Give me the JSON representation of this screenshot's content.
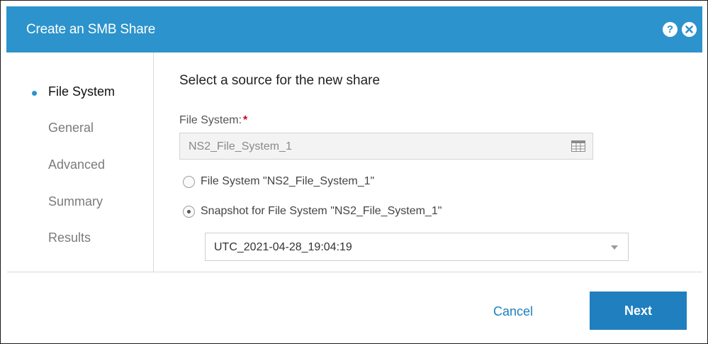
{
  "dialog": {
    "title": "Create an SMB Share",
    "icons": [
      "help-icon",
      "close-icon"
    ],
    "help_glyph": "?"
  },
  "steps": [
    {
      "label": "File System",
      "active": true
    },
    {
      "label": "General",
      "active": false
    },
    {
      "label": "Advanced",
      "active": false
    },
    {
      "label": "Summary",
      "active": false
    },
    {
      "label": "Results",
      "active": false
    }
  ],
  "main": {
    "heading": "Select a source for the new share",
    "file_system_label": "File System:",
    "required_mark": "*",
    "file_system_value": "NS2_File_System_1",
    "options": [
      {
        "label": "File System \"NS2_File_System_1\"",
        "checked": false
      },
      {
        "label": "Snapshot for File System \"NS2_File_System_1\"",
        "checked": true
      }
    ],
    "snapshot_selected": "UTC_2021-04-28_19:04:19"
  },
  "footer": {
    "cancel_label": "Cancel",
    "next_label": "Next"
  },
  "colors": {
    "header_bg": "#2c93cc",
    "primary_button": "#1f7fbf",
    "required": "#d0021b"
  }
}
